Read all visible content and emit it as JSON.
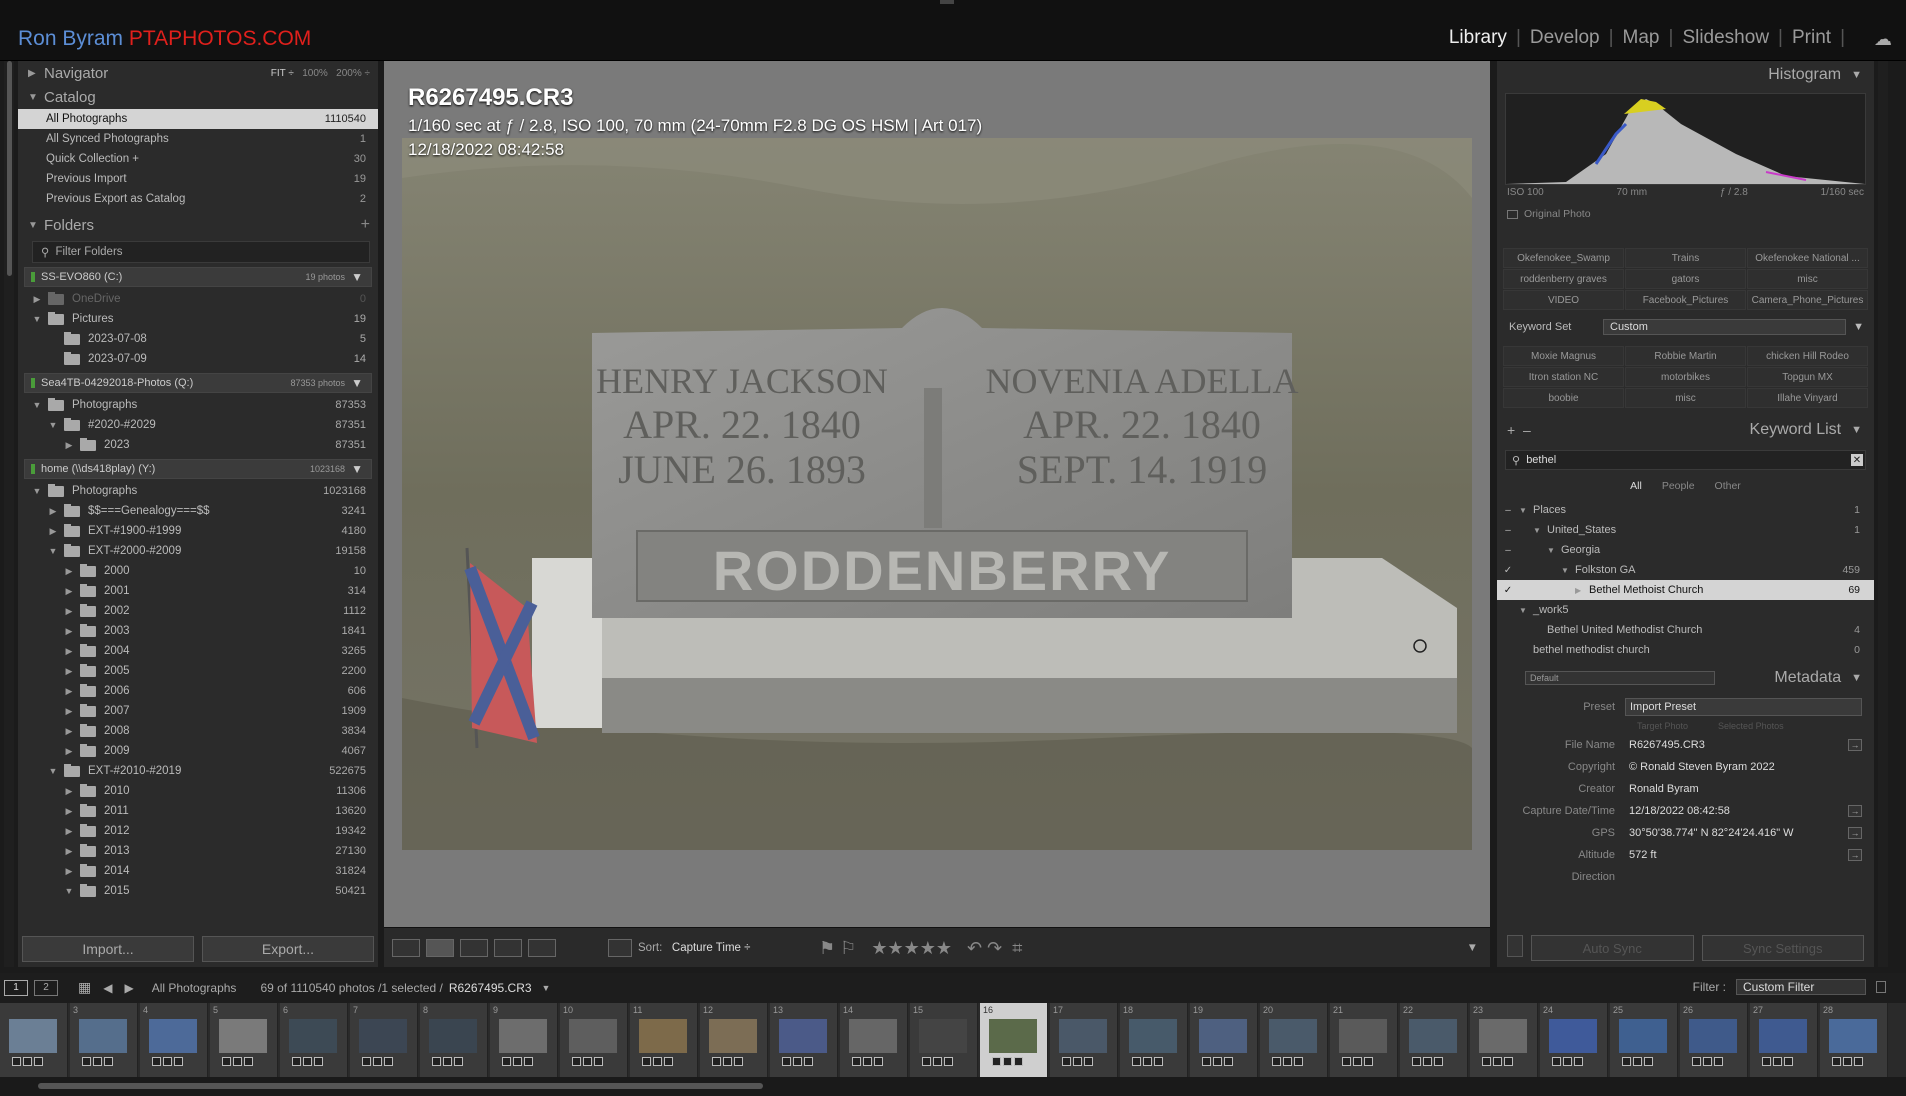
{
  "brand": {
    "name": "Ron Byram",
    "site": "PTAPHOTOS.COM"
  },
  "modules": [
    "Library",
    "Develop",
    "Map",
    "Slideshow",
    "Print"
  ],
  "navigator": {
    "label": "Navigator",
    "fit": "FIT ÷",
    "z1": "100%",
    "z2": "200% ÷"
  },
  "catalog": {
    "label": "Catalog",
    "items": [
      {
        "label": "All Photographs",
        "count": "1110540"
      },
      {
        "label": "All Synced Photographs",
        "count": "1"
      },
      {
        "label": "Quick Collection +",
        "count": "30"
      },
      {
        "label": "Previous Import",
        "count": "19"
      },
      {
        "label": "Previous Export as Catalog",
        "count": "2"
      }
    ]
  },
  "folders": {
    "label": "Folders",
    "plus": "+",
    "filter": "Filter Folders",
    "vol1": {
      "name": "SS-EVO860 (C:)",
      "count": "19 photos"
    },
    "vol1_items": [
      {
        "label": "OneDrive",
        "count": "0"
      },
      {
        "label": "Pictures",
        "count": "19"
      },
      {
        "label": "2023-07-08",
        "count": "5"
      },
      {
        "label": "2023-07-09",
        "count": "14"
      }
    ],
    "vol2": {
      "name": "Sea4TB-04292018-Photos (Q:)",
      "count": "87353 photos"
    },
    "vol2_items": [
      {
        "label": "Photographs",
        "count": "87353"
      },
      {
        "label": "#2020-#2029",
        "count": "87351"
      },
      {
        "label": "2023",
        "count": "87351"
      }
    ],
    "vol3": {
      "name": "home (\\\\ds418play) (Y:)",
      "count": "1023168"
    },
    "vol3_items": [
      {
        "label": "Photographs",
        "count": "1023168"
      },
      {
        "label": "$$===Genealogy===$$",
        "count": "3241"
      },
      {
        "label": "EXT-#1900-#1999",
        "count": "4180"
      },
      {
        "label": "EXT-#2000-#2009",
        "count": "19158"
      },
      {
        "label": "2000",
        "count": "10"
      },
      {
        "label": "2001",
        "count": "314"
      },
      {
        "label": "2002",
        "count": "1112"
      },
      {
        "label": "2003",
        "count": "1841"
      },
      {
        "label": "2004",
        "count": "3265"
      },
      {
        "label": "2005",
        "count": "2200"
      },
      {
        "label": "2006",
        "count": "606"
      },
      {
        "label": "2007",
        "count": "1909"
      },
      {
        "label": "2008",
        "count": "3834"
      },
      {
        "label": "2009",
        "count": "4067"
      },
      {
        "label": "EXT-#2010-#2019",
        "count": "522675"
      },
      {
        "label": "2010",
        "count": "11306"
      },
      {
        "label": "2011",
        "count": "13620"
      },
      {
        "label": "2012",
        "count": "19342"
      },
      {
        "label": "2013",
        "count": "27130"
      },
      {
        "label": "2014",
        "count": "31824"
      },
      {
        "label": "2015",
        "count": "50421"
      }
    ]
  },
  "buttons": {
    "import": "Import...",
    "export": "Export..."
  },
  "photo": {
    "title": "R6267495.CR3",
    "exposure": "1/160 sec at ƒ / 2.8, ISO 100, 70 mm (24-70mm F2.8 DG OS HSM | Art 017)",
    "date": "12/18/2022 08:42:58",
    "stone": {
      "name1": "HENRY JACKSON",
      "d1a": "APR. 22. 1840",
      "d1b": "JUNE 26. 1893",
      "name2": "NOVENIA ADELLA",
      "d2a": "APR. 22. 1840",
      "d2b": "SEPT. 14. 1919",
      "family": "RODDENBERRY"
    }
  },
  "toolbar": {
    "sort_label": "Sort:",
    "sort_value": "Capture Time ÷",
    "stars": "★★★★★"
  },
  "histogram": {
    "label": "Histogram",
    "iso": "ISO 100",
    "focal": "70 mm",
    "aperture": "ƒ / 2.8",
    "shutter": "1/160 sec",
    "original": "Original Photo"
  },
  "keyword_sug": [
    "Okefenokee_Swamp",
    "Trains",
    "Okefenokee National ...",
    "roddenberry graves",
    "gators",
    "misc",
    "VIDEO",
    "Facebook_Pictures",
    "Camera_Phone_Pictures"
  ],
  "keyword_set": {
    "label": "Keyword Set",
    "value": "Custom",
    "items": [
      "Moxie Magnus",
      "Robbie Martin",
      "chicken Hill Rodeo",
      "Itron station NC",
      "motorbikes",
      "Topgun MX",
      "boobie",
      "misc",
      "Illahe Vinyard"
    ]
  },
  "keyword_list": {
    "label": "Keyword List",
    "search": "bethel",
    "tabs": [
      "All",
      "People",
      "Other"
    ],
    "items": [
      {
        "label": "Places",
        "count": "1"
      },
      {
        "label": "United_States",
        "count": "1"
      },
      {
        "label": "Georgia",
        "count": ""
      },
      {
        "label": "Folkston GA",
        "count": "459"
      },
      {
        "label": "Bethel Methoist Church",
        "count": "69"
      },
      {
        "label": "_work5",
        "count": ""
      },
      {
        "label": "Bethel United Methodist Church",
        "count": "4"
      },
      {
        "label": "bethel methodist church",
        "count": "0"
      }
    ]
  },
  "metadata": {
    "label": "Metadata",
    "view": "Default",
    "preset_label": "Preset",
    "preset": "Import Preset",
    "target": "Target Photo",
    "selected": "Selected Photos",
    "fields": [
      {
        "label": "File Name",
        "value": "R6267495.CR3"
      },
      {
        "label": "Copyright",
        "value": "© Ronald Steven Byram 2022"
      },
      {
        "label": "Creator",
        "value": "Ronald Byram"
      },
      {
        "label": "Capture Date/Time",
        "value": "12/18/2022 08:42:58"
      },
      {
        "label": "GPS",
        "value": "30°50'38.774\" N 82°24'24.416\" W"
      },
      {
        "label": "Altitude",
        "value": "572 ft"
      },
      {
        "label": "Direction",
        "value": ""
      }
    ]
  },
  "sync": {
    "autosync": "Auto Sync",
    "settings": "Sync Settings"
  },
  "filmstrip": {
    "p1": "1",
    "p2": "2",
    "source": "All Photographs",
    "status": "69 of 1110540 photos /1 selected /",
    "file": "R6267495.CR3",
    "filter_label": "Filter :",
    "filter": "Custom Filter",
    "nums": [
      "",
      "3",
      "4",
      "5",
      "6",
      "7",
      "8",
      "9",
      "10",
      "11",
      "12",
      "13",
      "14",
      "15",
      "16",
      "17",
      "18",
      "19",
      "20",
      "21",
      "22",
      "23",
      "24",
      "25",
      "26",
      "27",
      "28"
    ]
  }
}
